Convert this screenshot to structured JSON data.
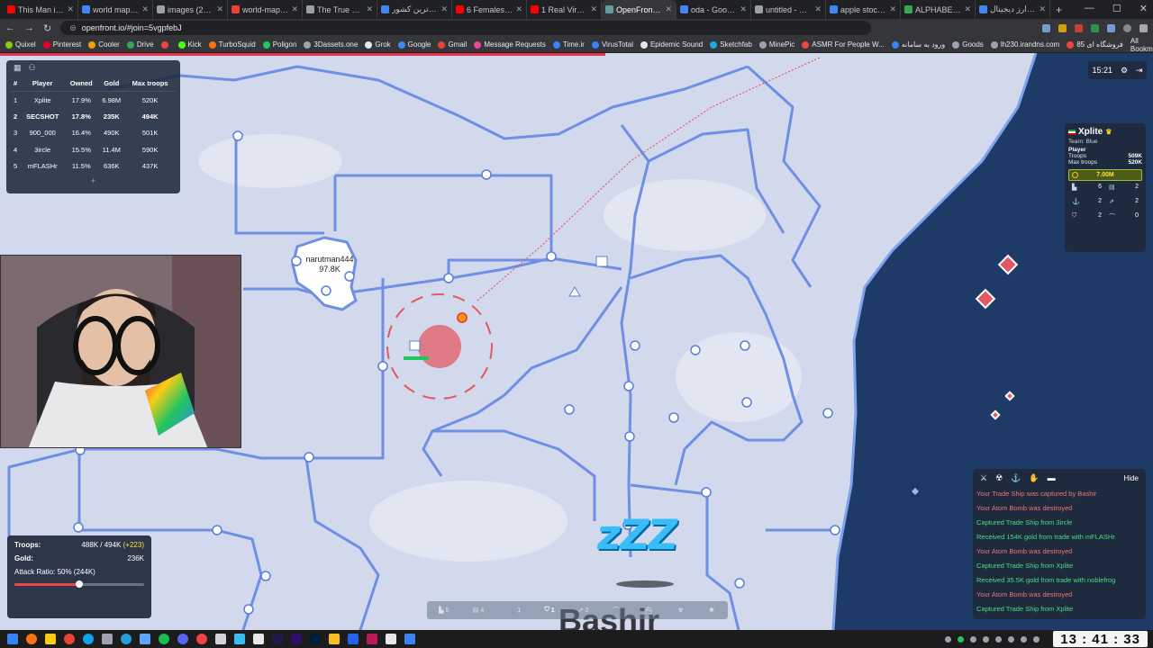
{
  "browser": {
    "tabs": [
      {
        "label": "This Man is a Me...",
        "color": "#ff0000",
        "active": false
      },
      {
        "label": "world map - Goo...",
        "color": "#4285f4",
        "active": false
      },
      {
        "label": "images (291×17...",
        "color": "#9aa0a6",
        "active": false
      },
      {
        "label": "world-map.gif (1...",
        "color": "#ea4335",
        "active": false
      },
      {
        "label": "The True Size Of...",
        "color": "#9aa0a6",
        "active": false
      },
      {
        "label": "پهناور ترین کشور...",
        "color": "#4285f4",
        "active": false
      },
      {
        "label": "6 Females vs 1 S...",
        "color": "#ff0000",
        "active": false
      },
      {
        "label": "1 Real Virgin vs 1...",
        "color": "#ff0000",
        "active": false
      },
      {
        "label": "OpenFront (ALP...",
        "color": "#5f9ea0",
        "active": true
      },
      {
        "label": "oda - Google Sea...",
        "color": "#4285f4",
        "active": false
      },
      {
        "label": "untitled - Paint",
        "color": "#9aa0a6",
        "active": false
      },
      {
        "label": "apple stock - Go...",
        "color": "#4285f4",
        "active": false
      },
      {
        "label": "ALPHABET A (E...",
        "color": "#34a853",
        "active": false
      },
      {
        "label": "خرید ارز دیجیتال",
        "color": "#4285f4",
        "active": false
      }
    ],
    "new_tab": "+",
    "url": "openfront.io/#join=5vgpfebJ",
    "all_bookmarks": "All Bookmarks",
    "bookmarks": [
      {
        "label": "Quixel",
        "color": "#84cc16"
      },
      {
        "label": "Pinterest",
        "color": "#e60023"
      },
      {
        "label": "Cooler",
        "color": "#f59e0b"
      },
      {
        "label": "Drive",
        "color": "#34a853"
      },
      {
        "label": "",
        "color": "#ef4444"
      },
      {
        "label": "Kick",
        "color": "#53fc18"
      },
      {
        "label": "TurboSquid",
        "color": "#f97316"
      },
      {
        "label": "Poligon",
        "color": "#22c55e"
      },
      {
        "label": "3Dassets.one",
        "color": "#9ca3af"
      },
      {
        "label": "Grok",
        "color": "#e5e7eb"
      },
      {
        "label": "Google",
        "color": "#4285f4"
      },
      {
        "label": "Gmail",
        "color": "#ea4335"
      },
      {
        "label": "Message Requests",
        "color": "#ec4899"
      },
      {
        "label": "Time.ir",
        "color": "#3b82f6"
      },
      {
        "label": "VirusTotal",
        "color": "#3b82f6"
      },
      {
        "label": "Epidemic Sound",
        "color": "#e5e7eb"
      },
      {
        "label": "Sketchfab",
        "color": "#1caad9"
      },
      {
        "label": "MinePic",
        "color": "#9ca3af"
      },
      {
        "label": "ASMR For People W...",
        "color": "#ef4444"
      },
      {
        "label": "ورود به سامانه",
        "color": "#3b82f6"
      },
      {
        "label": "Goods",
        "color": "#9ca3af"
      },
      {
        "label": "lh230.irandns.com",
        "color": "#9ca3af"
      },
      {
        "label": "فروشگاه ای 85",
        "color": "#ef4444"
      }
    ]
  },
  "leaderboard": {
    "headers": [
      "#",
      "Player",
      "Owned",
      "Gold",
      "Max troops"
    ],
    "rows": [
      {
        "rank": "1",
        "player": "Xplite",
        "owned": "17.9%",
        "gold": "6.98M",
        "max": "520K",
        "me": false
      },
      {
        "rank": "2",
        "player": "SECSHOT",
        "owned": "17.8%",
        "gold": "235K",
        "max": "494K",
        "me": true
      },
      {
        "rank": "3",
        "player": "900_000",
        "owned": "16.4%",
        "gold": "490K",
        "max": "501K",
        "me": false
      },
      {
        "rank": "4",
        "player": "3ircle",
        "owned": "15.5%",
        "gold": "11.4M",
        "max": "590K",
        "me": false
      },
      {
        "rank": "5",
        "player": "mFLASHr",
        "owned": "11.5%",
        "gold": "636K",
        "max": "437K",
        "me": false
      }
    ],
    "more": "+"
  },
  "timer": "15:21",
  "player_info": {
    "name": "Xplite",
    "team": "Team: Blue",
    "type": "Player",
    "troops_label": "Troops",
    "troops": "509K",
    "max_troops_label": "Max troops",
    "max_troops": "520K",
    "gold": "7.00M",
    "buildings": [
      {
        "icon": "city-icon",
        "value": "6"
      },
      {
        "icon": "factory-icon",
        "value": "2"
      },
      {
        "icon": "port-icon",
        "value": "2"
      },
      {
        "icon": "missile-silo-icon",
        "value": "2"
      },
      {
        "icon": "defense-post-icon",
        "value": "2"
      },
      {
        "icon": "sam-launcher-icon",
        "value": "0"
      }
    ]
  },
  "map": {
    "player_label_name": "narutman444",
    "player_label_troops": "97.8K"
  },
  "troops_panel": {
    "troops_label": "Troops:",
    "troops_value": "488K / 494K",
    "troops_delta": "(+223)",
    "gold_label": "Gold:",
    "gold_value": "236K",
    "attack_ratio_label": "Attack Ratio: 50% (244K)",
    "attack_ratio": 0.5
  },
  "build_bar": [
    {
      "icon": "city-icon",
      "count": "5",
      "selected": false
    },
    {
      "icon": "factory-icon",
      "count": "4",
      "selected": false
    },
    {
      "icon": "port-icon",
      "count": "1",
      "selected": false
    },
    {
      "icon": "defense-post-icon",
      "count": "1",
      "selected": true
    },
    {
      "icon": "missile-silo-icon",
      "count": "2",
      "selected": false
    },
    {
      "icon": "sam-launcher-icon",
      "count": "",
      "selected": false
    },
    {
      "icon": "warship-icon",
      "count": "",
      "selected": false
    },
    {
      "icon": "atom-bomb-icon",
      "count": "",
      "selected": false
    },
    {
      "icon": "hydrogen-bomb-icon",
      "count": "",
      "selected": false
    }
  ],
  "events": {
    "hide_label": "Hide",
    "messages": [
      {
        "text": "Your Trade Ship was captured by Bashir",
        "color": "#f87171"
      },
      {
        "text": "Your Atom Bomb was destroyed",
        "color": "#f87171"
      },
      {
        "text": "Captured Trade Ship from 3ircle",
        "color": "#4ade80"
      },
      {
        "text": "Received 154K gold from trade with mFLASHr",
        "color": "#4ade80"
      },
      {
        "text": "Your Atom Bomb was destroyed",
        "color": "#f87171"
      },
      {
        "text": "Captured Trade Ship from Xplite",
        "color": "#4ade80"
      },
      {
        "text": "Received 35.5K gold from trade with noblefrog",
        "color": "#4ade80"
      },
      {
        "text": "Your Atom Bomb was destroyed",
        "color": "#f87171"
      },
      {
        "text": "Captured Trade Ship from Xplite",
        "color": "#4ade80"
      }
    ]
  },
  "sleep_indicator": "zZZ",
  "big_player_name": "Bashir",
  "taskbar": {
    "clock": "13 : 41 : 33"
  },
  "colors": {
    "land": "#d2d9ec",
    "border": "#6e8fe3",
    "ocean": "#1e3a66",
    "nuke": "#e25863"
  }
}
